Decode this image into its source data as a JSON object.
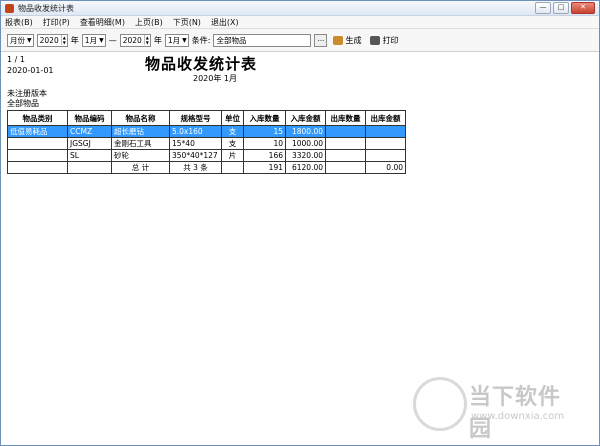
{
  "window": {
    "title": "物品收发统计表",
    "min_glyph": "—",
    "max_glyph": "□",
    "close_glyph": "✕"
  },
  "menu": {
    "items": [
      "报表(B)",
      "打印(P)",
      "查看明细(M)",
      "上页(B)",
      "下页(N)",
      "退出(X)"
    ]
  },
  "toolbar": {
    "period_type": "月份",
    "start_year": "2020",
    "start_month": "1月",
    "year_label": "年",
    "separator": "—",
    "end_year": "2020",
    "end_month": "1月",
    "condition_label": "条件:",
    "condition_value": "全部物品",
    "dots": "...",
    "generate_label": "生成",
    "print_label": "打印"
  },
  "report": {
    "page_no": "1 / 1",
    "date": "2020-01-01",
    "title": "物品收发统计表",
    "period": "2020年  1月",
    "unregistered": "未注册版本",
    "scope": "全部物品",
    "columns": [
      "物品类别",
      "物品编码",
      "物品名称",
      "规格型号",
      "单位",
      "入库数量",
      "入库金额",
      "出库数量",
      "出库金额"
    ],
    "rows": [
      [
        "低值易耗品",
        "CCMZ",
        "超长磨钻",
        "5.0x160",
        "支",
        "15",
        "1800.00",
        "",
        ""
      ],
      [
        "",
        "JGSGJ",
        "金刚石工具",
        "15*40",
        "支",
        "10",
        "1000.00",
        "",
        ""
      ],
      [
        "",
        "SL",
        "砂轮",
        "350*40*127",
        "片",
        "166",
        "3320.00",
        "",
        ""
      ]
    ],
    "total": {
      "label": "总  计",
      "count_text": "共 3 条",
      "in_qty": "191",
      "in_amount": "6120.00",
      "out_qty": "",
      "out_amount": "0.00"
    }
  },
  "watermark": {
    "text": "当下软件园",
    "url": "www.downxia.com"
  }
}
